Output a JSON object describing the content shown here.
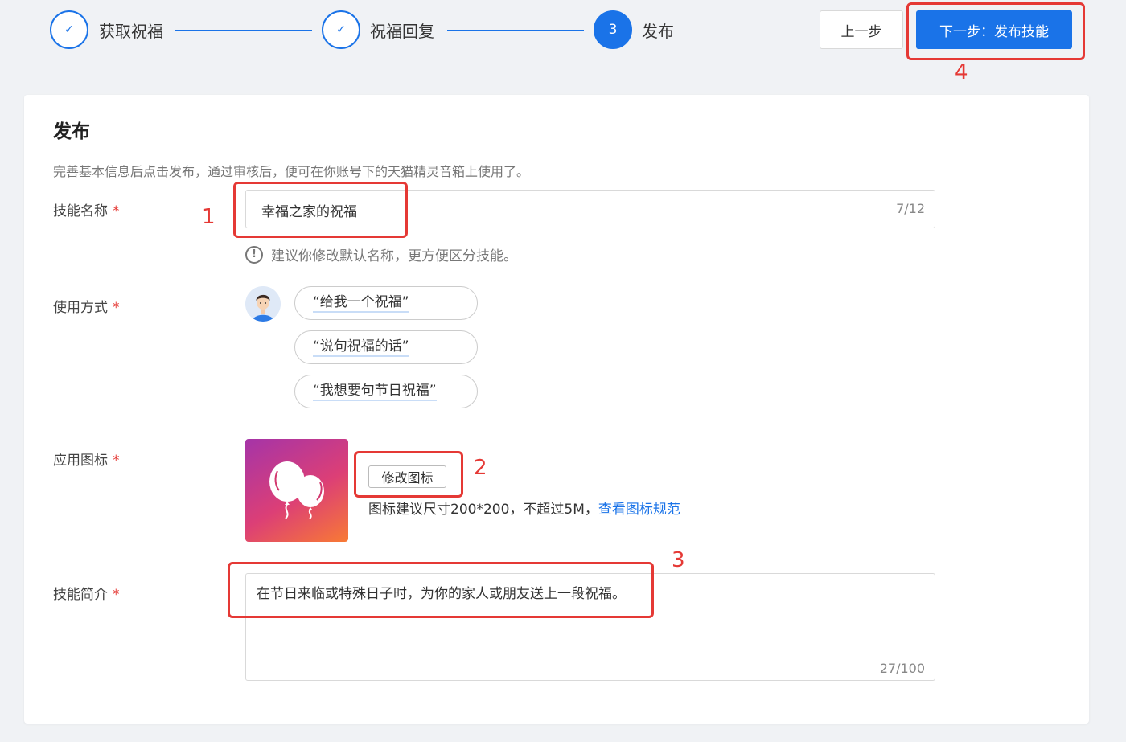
{
  "steps": [
    {
      "label": "获取祝福",
      "status": "done",
      "mark": "✓"
    },
    {
      "label": "祝福回复",
      "status": "done",
      "mark": "✓"
    },
    {
      "label": "发布",
      "status": "active",
      "mark": "3"
    }
  ],
  "toolbar": {
    "prev_label": "上一步",
    "next_label": "下一步：发布技能"
  },
  "annotations": [
    "1",
    "2",
    "3",
    "4"
  ],
  "card": {
    "title": "发布",
    "description": "完善基本信息后点击发布，通过审核后，便可在你账号下的天猫精灵音箱上使用了。"
  },
  "form": {
    "required_mark": "*",
    "name": {
      "label": "技能名称",
      "value": "幸福之家的祝福",
      "count": "7/12",
      "hint": "建议你修改默认名称，更方便区分技能。",
      "hint_icon": "!"
    },
    "usage": {
      "label": "使用方式",
      "utterances": [
        "“给我一个祝福”",
        "“说句祝福的话”",
        "“我想要句节日祝福”"
      ]
    },
    "icon": {
      "label": "应用图标",
      "change_label": "修改图标",
      "tip": "图标建议尺寸200*200，不超过5M，",
      "link": "查看图标规范"
    },
    "intro": {
      "label": "技能简介",
      "value": "在节日来临或特殊日子时，为你的家人或朋友送上一段祝福。",
      "count": "27/100"
    }
  },
  "colors": {
    "primary": "#1a73e8",
    "annotation": "#e53935",
    "background": "#f0f2f5"
  }
}
